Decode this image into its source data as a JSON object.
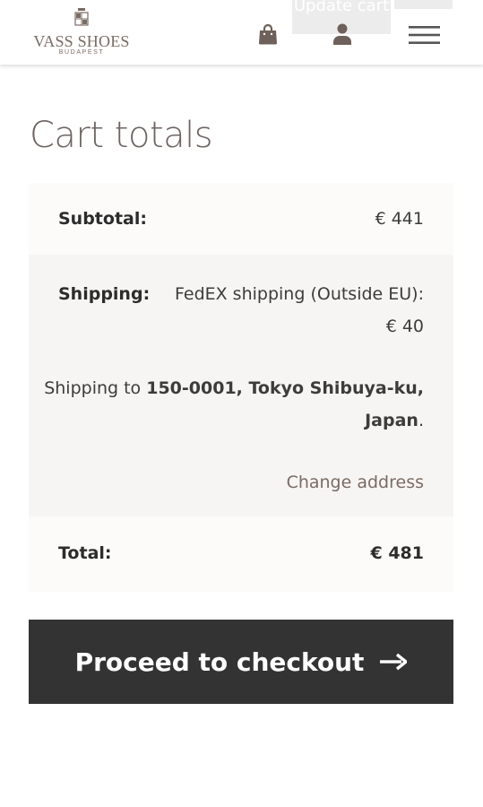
{
  "header": {
    "ghost_button_label": "Update cart",
    "logo": {
      "crest_text": "VASS",
      "name": "VASS SHOES",
      "subtitle": "BUDAPEST"
    },
    "icons": {
      "bag": "shopping-bag-icon",
      "account": "user-icon",
      "menu": "hamburger-menu-icon"
    }
  },
  "cart_totals": {
    "title": "Cart totals",
    "subtotal": {
      "label": "Subtotal:",
      "value": "€ 441"
    },
    "shipping": {
      "label": "Shipping:",
      "method": "FedEX shipping (Outside EU):",
      "price": "€ 40",
      "destination_prefix": "Shipping to ",
      "destination_part1": "150-0001, Tokyo Shibuya-ku,",
      "destination_part2": "Japan",
      "destination_suffix": ".",
      "change_address": "Change address"
    },
    "total": {
      "label": "Total:",
      "value": "€ 481"
    }
  },
  "checkout": {
    "label": "Proceed to checkout",
    "icon": "arrow-right-icon"
  },
  "colors": {
    "brand": "#7a6b63",
    "button_bg": "#333333",
    "row_light": "#fcfbfa",
    "row_dark": "#f7f5f3"
  }
}
